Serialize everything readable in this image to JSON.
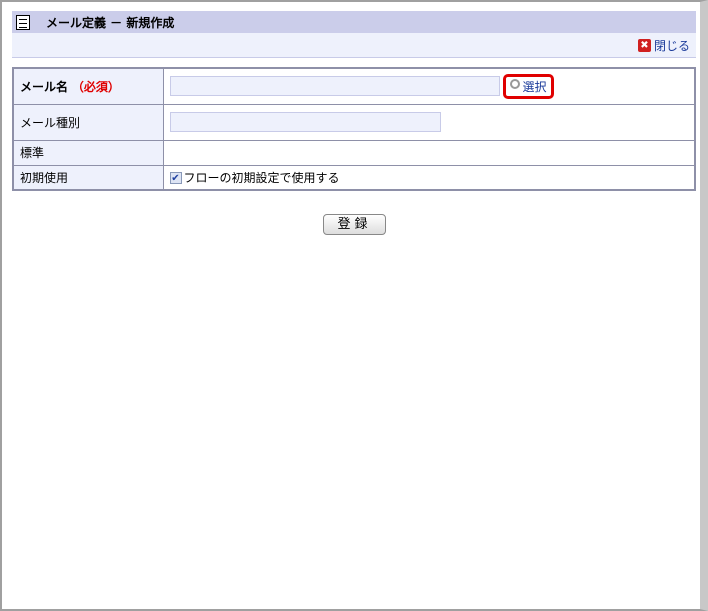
{
  "header": {
    "title": "メール定義 － 新規作成",
    "close_label": "閉じる"
  },
  "form": {
    "rows": [
      {
        "label": "メール名",
        "required": "（必須）",
        "value": "",
        "select_label": "選択"
      },
      {
        "label": "メール種別",
        "value": ""
      },
      {
        "label": "標準",
        "value": ""
      },
      {
        "label": "初期使用",
        "checkbox_label": "フローの初期設定で使用する",
        "checked": true
      }
    ]
  },
  "submit_label": "登録"
}
